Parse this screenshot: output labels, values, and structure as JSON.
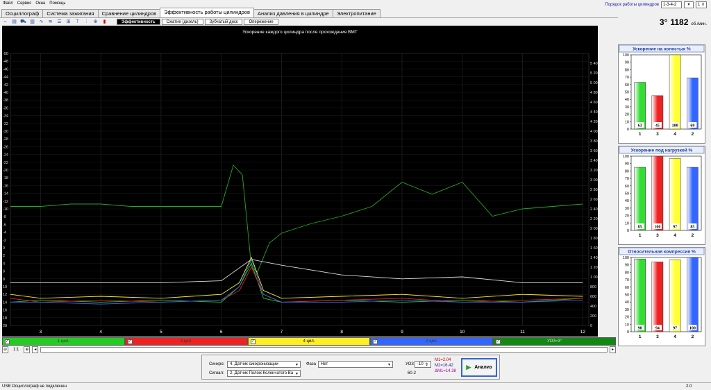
{
  "menu": [
    "Файл",
    "Сервис",
    "Окна",
    "Помощь"
  ],
  "firing_order": {
    "label": "Порядок работы цилиндров",
    "value": "1-3-4-2",
    "stepper": "1"
  },
  "tabs": [
    {
      "label": "Осциллограф",
      "active": false
    },
    {
      "label": "Система зажигания",
      "active": false
    },
    {
      "label": "Сравнение цилиндров",
      "active": false
    },
    {
      "label": "Эффективность работы цилиндров",
      "active": true
    },
    {
      "label": "Анализ давления в цилиндре",
      "active": false
    },
    {
      "label": "Электропитание",
      "active": false
    }
  ],
  "modes": [
    {
      "label": "Эффективность",
      "active": true
    },
    {
      "label": "Сжатие (дизель)",
      "active": false
    },
    {
      "label": "Зубчатый диск",
      "active": false
    },
    {
      "label": "Опережение",
      "active": false
    }
  ],
  "indicator": {
    "angle": "3°",
    "rpm": "1182",
    "unit": "об./мин."
  },
  "colors": {
    "green": "#22cc22",
    "red": "#ee2222",
    "yellow": "#ffee22",
    "blue": "#3366ff",
    "uoz": "#118811"
  },
  "cylinders": [
    {
      "label": "1 цил.",
      "color": "#22cc22"
    },
    {
      "label": "3 цил.",
      "color": "#ee2222"
    },
    {
      "label": "4 цил.",
      "color": "#ffee22"
    },
    {
      "label": "2 цил.",
      "color": "#3366ff"
    },
    {
      "label": "УОЗ=3°",
      "color": "#118811"
    }
  ],
  "scroll": {
    "zoom": "1:1"
  },
  "bottom": {
    "sinhro_label": "Синхро:",
    "sinhro_value": "4. Датчик синхронизации",
    "signal_label": "Сигнал:",
    "signal_value": "2. Датчик Полож Коленчатого Ва",
    "faza_label": "Фаза",
    "faza_value": "Нет",
    "uoz_label": "УОЗ",
    "uoz_value": "-10",
    "pattern": "60-2",
    "m1": "M1=2.04",
    "m2": "M2=16.42",
    "dm": "ΔM1=14.38",
    "analyze": "Анализ"
  },
  "status": {
    "text": "USB Осциллограф не подключен",
    "version": "2.0"
  },
  "chart_data": {
    "type": "line",
    "title": "Ускорение каждого цилиндра после прохождения ВМТ",
    "x_ticks": [
      "3",
      "4",
      "5",
      "6",
      "7",
      "8",
      "9",
      "10",
      "11",
      "12"
    ],
    "xlim": [
      2.5,
      12.1
    ],
    "left_axis": {
      "ylim": [
        -50,
        20
      ],
      "ticks": [
        -50,
        -48,
        -46,
        -44,
        -42,
        -40,
        -38,
        -36,
        -34,
        -32,
        -30,
        -28,
        -26,
        -24,
        -22,
        -20,
        -18,
        -16,
        -14,
        -12,
        -10,
        -8,
        -6,
        -4,
        -2,
        0,
        2,
        4,
        6,
        8,
        10,
        12,
        14,
        16,
        18,
        20
      ]
    },
    "right_axis": {
      "ylim": [
        0,
        5600
      ],
      "ticks": [
        "0",
        "200",
        "400",
        "600",
        "800",
        "1 000",
        "1 200",
        "1 400",
        "1 600",
        "1 800",
        "2 000",
        "2 200",
        "2 400",
        "2 600",
        "2 800",
        "3 000",
        "3 200",
        "3 400",
        "3 600",
        "3 800",
        "4 000",
        "4 200",
        "4 400",
        "4 600",
        "4 800",
        "5 000",
        "5 200",
        "5 400"
      ]
    },
    "series": [
      {
        "color": "#22aa22",
        "axis": "right",
        "x": [
          2.5,
          3,
          3.5,
          4,
          4.5,
          5,
          5.5,
          6,
          6.2,
          6.35,
          6.5,
          6.6,
          6.8,
          7,
          7.5,
          8,
          8.5,
          9,
          9.5,
          10,
          10.5,
          11,
          11.5,
          12
        ],
        "y": [
          2450,
          2450,
          2500,
          2500,
          2450,
          2450,
          2450,
          2450,
          3300,
          3100,
          1200,
          1100,
          1700,
          1900,
          2100,
          2250,
          2450,
          2950,
          2700,
          2950,
          2250,
          2400,
          2450,
          2500
        ]
      },
      {
        "color": "#dddddd",
        "axis": "left",
        "x": [
          2.5,
          3,
          4,
          5,
          6,
          6.5,
          7,
          8,
          9,
          10,
          11,
          12
        ],
        "y": [
          9,
          9,
          9,
          9,
          8.5,
          3,
          4.5,
          7,
          8,
          7.5,
          9,
          9
        ]
      },
      {
        "color": "#22cc22",
        "axis": "left",
        "x": [
          2.5,
          3,
          4,
          5,
          6,
          6.3,
          6.5,
          6.7,
          7,
          8,
          9,
          10,
          11,
          12
        ],
        "y": [
          14,
          13.5,
          14,
          13.5,
          14,
          10,
          4,
          13,
          14,
          13.5,
          14,
          13.5,
          14,
          13
        ]
      },
      {
        "color": "#ee2222",
        "axis": "left",
        "x": [
          2.5,
          3,
          4,
          5,
          6,
          6.3,
          6.5,
          6.7,
          7,
          8,
          9,
          10,
          11,
          12
        ],
        "y": [
          13,
          14,
          13.5,
          14,
          13.5,
          11,
          5,
          12,
          14,
          13.5,
          13,
          14,
          13.5,
          13
        ]
      },
      {
        "color": "#ffee22",
        "axis": "left",
        "x": [
          2.5,
          3,
          4,
          5,
          6,
          6.3,
          6.5,
          6.7,
          7,
          8,
          9,
          10,
          11,
          12
        ],
        "y": [
          12,
          13,
          12.5,
          13,
          12,
          9,
          2.5,
          11,
          13,
          12.5,
          12,
          13,
          12,
          12.5
        ]
      },
      {
        "color": "#3366ff",
        "axis": "left",
        "x": [
          2.5,
          3,
          4,
          5,
          6,
          6.3,
          6.5,
          6.7,
          7,
          8,
          9,
          10,
          11,
          12
        ],
        "y": [
          14,
          14,
          14.5,
          14,
          13.5,
          10,
          3,
          12,
          14,
          14,
          13.5,
          14,
          14,
          13.5
        ]
      }
    ]
  },
  "bar_charts": [
    {
      "title": "Ускорение на холостых %",
      "categories": [
        "1",
        "3",
        "4",
        "2"
      ],
      "values": [
        63,
        45,
        100,
        69
      ],
      "colors": [
        "#33dd33",
        "#ee2222",
        "#ffff33",
        "#3366ff"
      ],
      "ylim": [
        0,
        100
      ]
    },
    {
      "title": "Ускорение под нагрузкой %",
      "categories": [
        "1",
        "3",
        "4",
        "2"
      ],
      "values": [
        85,
        100,
        97,
        85
      ],
      "colors": [
        "#33dd33",
        "#ee2222",
        "#ffff33",
        "#3366ff"
      ],
      "ylim": [
        0,
        100
      ]
    },
    {
      "title": "Относительная компрессия %",
      "categories": [
        "1",
        "3",
        "4",
        "2"
      ],
      "values": [
        98,
        94,
        97,
        100
      ],
      "colors": [
        "#33dd33",
        "#ee2222",
        "#ffff33",
        "#3366ff"
      ],
      "ylim": [
        0,
        100
      ]
    }
  ]
}
